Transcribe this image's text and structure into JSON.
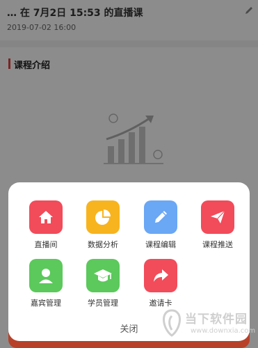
{
  "course": {
    "title": "… 在 7月2日 15:53 的直播课",
    "date": "2019-07-02 16:00"
  },
  "section": {
    "title": "课程介绍"
  },
  "actions": [
    {
      "label": "直播间",
      "icon": "home-icon",
      "color": "#f24b5a"
    },
    {
      "label": "数据分析",
      "icon": "pie-chart-icon",
      "color": "#f8b41e"
    },
    {
      "label": "课程编辑",
      "icon": "pencil-icon",
      "color": "#6aa7f5"
    },
    {
      "label": "课程推送",
      "icon": "paper-plane-icon",
      "color": "#f24b5a"
    },
    {
      "label": "嘉宾管理",
      "icon": "guest-user-icon",
      "color": "#5bc95b"
    },
    {
      "label": "学员管理",
      "icon": "graduation-cap-icon",
      "color": "#5bc95b"
    },
    {
      "label": "邀请卡",
      "icon": "share-arrow-icon",
      "color": "#f24b5a"
    }
  ],
  "close_label": "关闭",
  "watermark": {
    "name": "当下软件园",
    "url": "www.downxia.com"
  }
}
